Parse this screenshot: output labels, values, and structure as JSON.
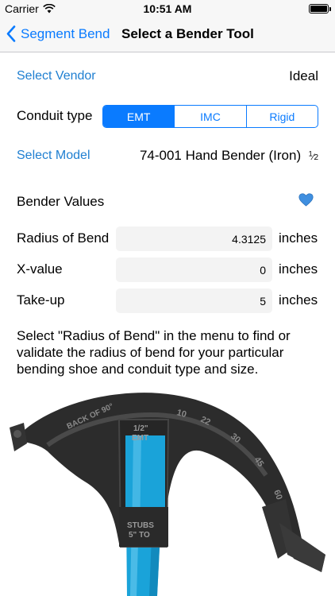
{
  "status_bar": {
    "carrier": "Carrier",
    "time": "10:51 AM",
    "battery_level": 1.0
  },
  "nav": {
    "back_label": "Segment Bend",
    "title": "Select a Bender Tool"
  },
  "vendor": {
    "label": "Select Vendor",
    "value": "Ideal"
  },
  "conduit": {
    "label": "Conduit type",
    "options": [
      "EMT",
      "IMC",
      "Rigid"
    ],
    "selected": "EMT"
  },
  "model": {
    "label": "Select Model",
    "value": "74-001 Hand Bender (Iron)",
    "frac_num": "1",
    "frac_den": "2"
  },
  "bender_values": {
    "label": "Bender Values",
    "favorite_icon": "heart-icon",
    "favorite_color": "#3f8fe0"
  },
  "fields": {
    "radius": {
      "label": "Radius of Bend",
      "value": "4.3125",
      "unit": "inches"
    },
    "xvalue": {
      "label": "X-value",
      "value": "0",
      "unit": "inches"
    },
    "takeup": {
      "label": "Take-up",
      "value": "5",
      "unit": "inches"
    }
  },
  "description": "Select \"Radius of Bend\" in the menu to find or validate the radius of bend for your particular bending shoe and conduit type and size.",
  "tool_image": {
    "markings": [
      "BACK OF 90°",
      "10",
      "22",
      "30",
      "45",
      "60",
      "1/2\"",
      "EMT",
      "STUBS",
      "5\" TO"
    ],
    "colors": {
      "body": "#2c2c2c",
      "handle": "#1aa3d9"
    }
  }
}
